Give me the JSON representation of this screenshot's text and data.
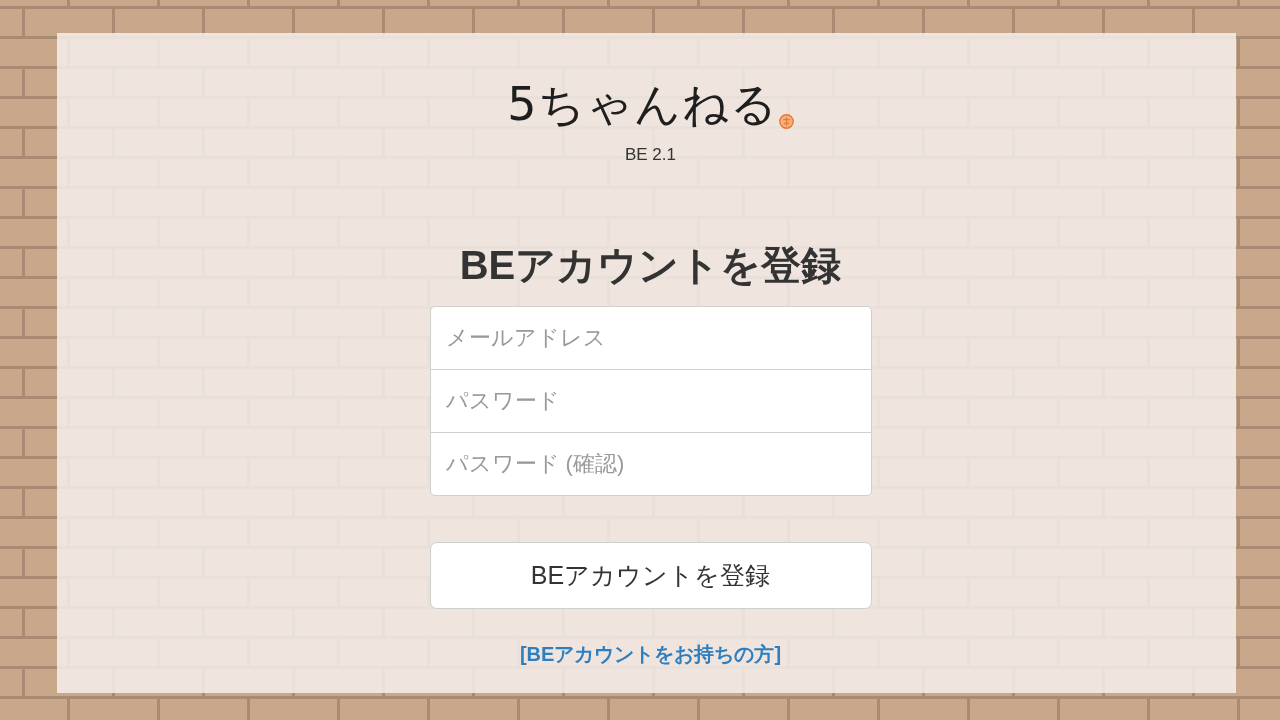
{
  "logo": {
    "wordmark": "5ちゃんねる",
    "version": "BE 2.1"
  },
  "heading": "BEアカウントを登録",
  "fields": [
    {
      "placeholder": "メールアドレス"
    },
    {
      "placeholder": "パスワード"
    },
    {
      "placeholder": "パスワード (確認)"
    }
  ],
  "submit_button": "BEアカウントを登録",
  "login_link": "[BEアカウントをお持ちの方]"
}
